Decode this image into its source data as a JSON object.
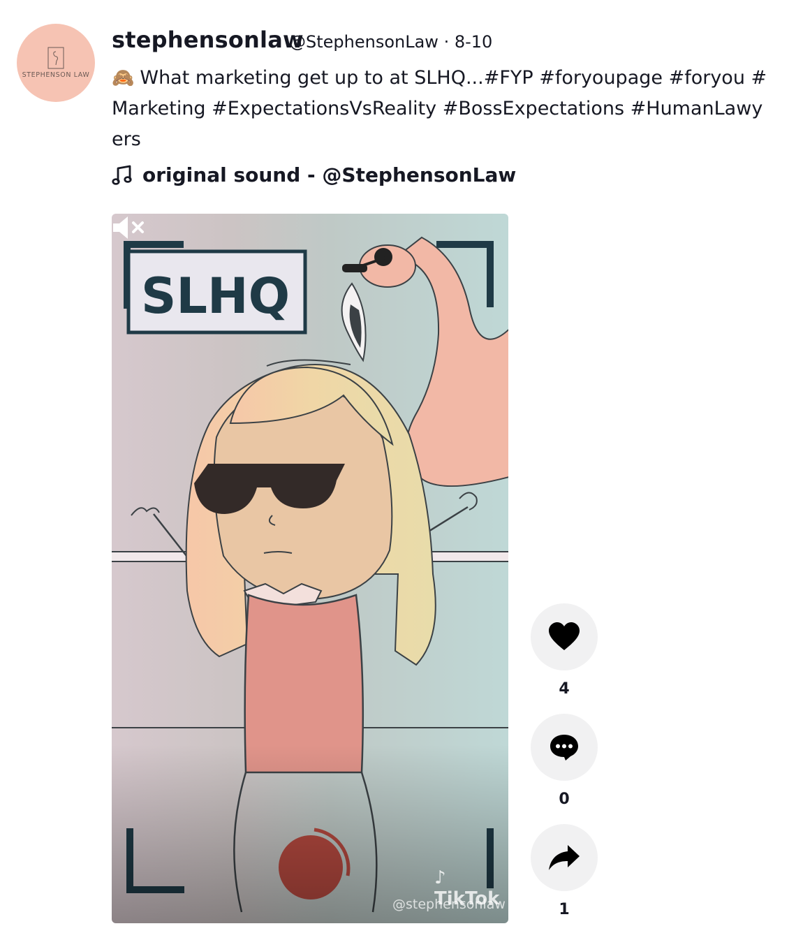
{
  "author": {
    "username": "stephensonlaw",
    "handle": "@StephensonLaw",
    "date": "8-10",
    "avatar_text": "STEPHENSON LAW"
  },
  "post": {
    "caption": "What marketing get up to at SLHQ...#FYP #foryoupage #foryou #Marketing #ExpectationsVsReality #BossExpectations #HumanLawyers",
    "emoji": "🙈",
    "sound": "original sound - @StephensonLaw"
  },
  "video": {
    "sign_text": "SLHQ",
    "watermark_brand": "TikTok",
    "watermark_handle": "@stephensonlaw",
    "muted": true
  },
  "actions": {
    "likes": "4",
    "comments": "0",
    "shares": "1"
  }
}
